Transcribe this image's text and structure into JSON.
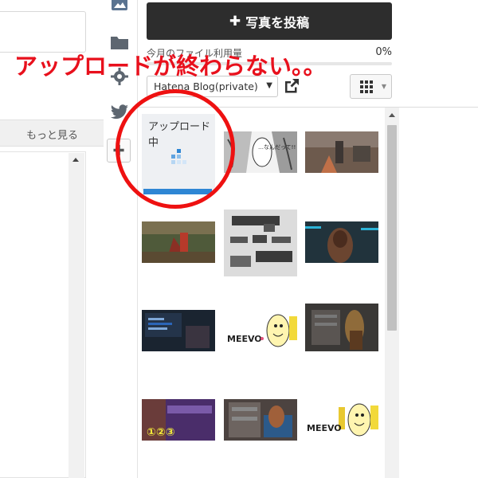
{
  "editor": {
    "more_link": "もっと見る"
  },
  "sidebar_icons": [
    "image-icon",
    "folder-icon",
    "gear-icon",
    "twitter-icon",
    "plus-icon"
  ],
  "photo_panel": {
    "post_button_label": "写真を投稿",
    "usage_label": "今月のファイル利用量",
    "usage_percent": "0%",
    "usage_value": 0,
    "blog_select_value": "Hatena Blog(private)",
    "upload_status": "アップロード中",
    "thumbnails": [
      {
        "name": "manga-panel-thumb",
        "caption_text": "…なんだって!!"
      },
      {
        "name": "game-screenshot-thumb"
      },
      {
        "name": "game-screenshot-thumb"
      },
      {
        "name": "weapon-items-thumb"
      },
      {
        "name": "game-screenshot-thumb"
      },
      {
        "name": "game-screenshot-thumb"
      },
      {
        "name": "meevo-logo-thumb",
        "caption_text": "MEEVO"
      },
      {
        "name": "game-screenshot-thumb"
      },
      {
        "name": "game-banner-thumb",
        "caption_text": "①②③"
      },
      {
        "name": "game-screenshot-thumb"
      },
      {
        "name": "meevo-logo-thumb",
        "caption_text": "MEEVO"
      }
    ]
  },
  "annotation": {
    "text": "アップロードが終わらない。。",
    "color": "#e8101c"
  },
  "colors": {
    "button_dark": "#2d2d2d",
    "progress_blue": "#2e86d4"
  }
}
